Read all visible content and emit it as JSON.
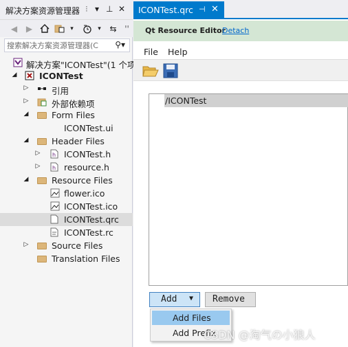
{
  "solution_explorer": {
    "title": "解决方案资源管理器",
    "search_placeholder": "搜索解决方案资源管理器(C",
    "solution_label": "解决方案\"ICONTest\"(1 个项",
    "project_label": "ICONTest",
    "items": [
      {
        "label": "引用"
      },
      {
        "label": "外部依赖项"
      },
      {
        "label": "Form Files"
      },
      {
        "label": "ICONTest.ui"
      },
      {
        "label": "Header Files"
      },
      {
        "label": "ICONTest.h"
      },
      {
        "label": "resource.h"
      },
      {
        "label": "Resource Files"
      },
      {
        "label": "flower.ico"
      },
      {
        "label": "ICONTest.ico"
      },
      {
        "label": "ICONTest.qrc"
      },
      {
        "label": "ICONTest.rc"
      },
      {
        "label": "Source Files"
      },
      {
        "label": "Translation Files"
      }
    ]
  },
  "document": {
    "tab_title": "ICONTest.qrc",
    "qt_header": "Qt Resource Editor",
    "detach_link": "Detach",
    "menu": [
      "File",
      "Help"
    ],
    "prefix_item": "/ICONTest",
    "add_button": "Add",
    "remove_button": "Remove",
    "dropdown_options": [
      "Add Files",
      "Add Prefix"
    ]
  },
  "watermark": "CSDN @淘气の小狼人",
  "colors": {
    "accent": "#007acc",
    "selection": "#cce8ff",
    "qt_header_bg": "#d4e6d4",
    "dropdown_highlight": "#99c9ef"
  }
}
